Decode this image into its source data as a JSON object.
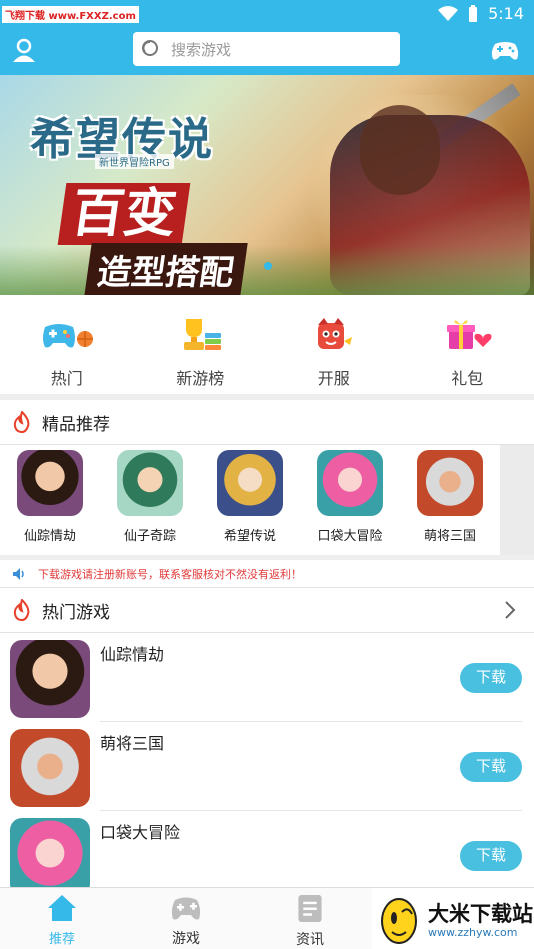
{
  "status_bar": {
    "watermark": "飞翔下载 www.FXXZ.com",
    "time": "5:14"
  },
  "header": {
    "search_placeholder": "搜索游戏",
    "accent": "#35b9e8"
  },
  "banner": {
    "logo": "希望传说",
    "logo_sub": "新世界冒险RPG",
    "slogan_1": "百变",
    "slogan_2": "造型搭配"
  },
  "quick_nav": [
    {
      "label": "热门",
      "icon": "gamepad-ball-icon"
    },
    {
      "label": "新游榜",
      "icon": "trophy-icon"
    },
    {
      "label": "开服",
      "icon": "server-mascot-icon"
    },
    {
      "label": "礼包",
      "icon": "gift-heart-icon"
    }
  ],
  "featured": {
    "title": "精品推荐",
    "items": [
      {
        "label": "仙踪情劫"
      },
      {
        "label": "仙子奇踪"
      },
      {
        "label": "希望传说"
      },
      {
        "label": "口袋大冒险"
      },
      {
        "label": "萌将三国"
      }
    ]
  },
  "notice": {
    "text": "下载游戏请注册新账号，联系客服核对不然没有返利！"
  },
  "hot_games": {
    "title": "热门游戏",
    "items": [
      {
        "name": "仙踪情劫",
        "button": "下载"
      },
      {
        "name": "萌将三国",
        "button": "下载"
      },
      {
        "name": "口袋大冒险",
        "button": "下载"
      }
    ]
  },
  "tabbar": [
    {
      "label": "推荐",
      "active": true
    },
    {
      "label": "游戏",
      "active": false
    },
    {
      "label": "资讯",
      "active": false
    }
  ],
  "brand_watermark": {
    "title": "大米下载站",
    "url": "www.zzhyw.com"
  }
}
